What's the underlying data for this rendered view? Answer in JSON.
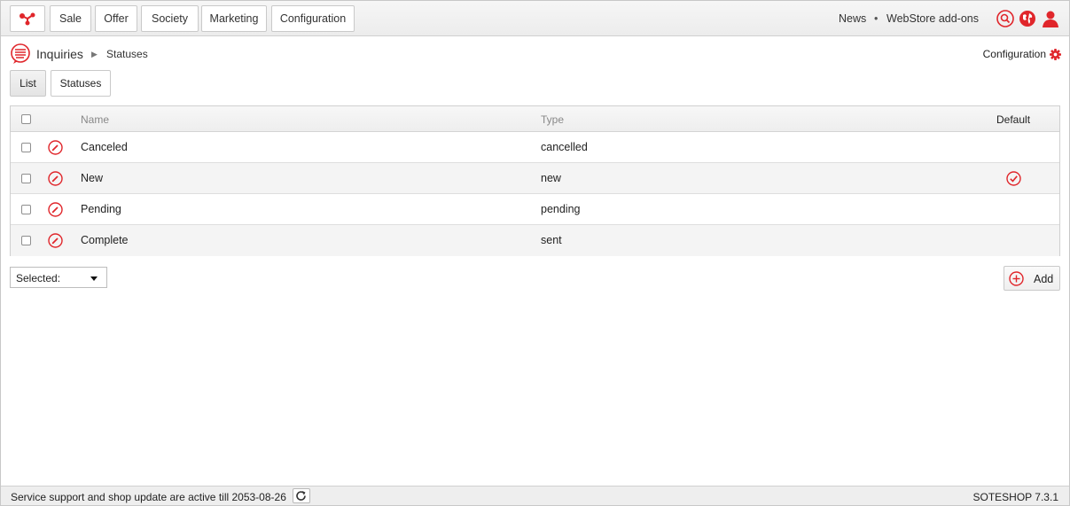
{
  "topbar": {
    "menu": [
      "Sale",
      "Offer",
      "Society",
      "Marketing",
      "Configuration"
    ],
    "links": {
      "news": "News",
      "separator": "•",
      "addons": "WebStore add-ons"
    },
    "icons": [
      "search-icon",
      "globe-icon",
      "user-icon"
    ]
  },
  "breadcrumb": {
    "section": "Inquiries",
    "page": "Statuses"
  },
  "config_link": "Configuration",
  "tabs": {
    "list": "List",
    "statuses": "Statuses"
  },
  "table": {
    "headers": {
      "name": "Name",
      "type": "Type",
      "default": "Default"
    },
    "rows": [
      {
        "name": "Canceled",
        "type": "cancelled",
        "is_default": false
      },
      {
        "name": "New",
        "type": "new",
        "is_default": true
      },
      {
        "name": "Pending",
        "type": "pending",
        "is_default": false
      },
      {
        "name": "Complete",
        "type": "sent",
        "is_default": false
      }
    ]
  },
  "actions": {
    "selected_label": "Selected:",
    "add_label": "Add"
  },
  "footer": {
    "support_text": "Service support and shop update are active till 2053-08-26",
    "version": "SOTESHOP 7.3.1"
  },
  "colors": {
    "accent": "#e0262b",
    "header_bg": "#eeeeee"
  }
}
